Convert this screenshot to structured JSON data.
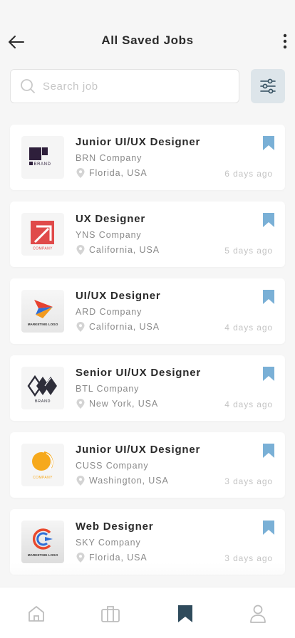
{
  "header": {
    "title": "All Saved Jobs"
  },
  "search": {
    "placeholder": "Search job",
    "value": ""
  },
  "colors": {
    "accent": "#2f4b5c",
    "bookmark": "#7ab0d6",
    "filter_bg": "#dde5ea"
  },
  "jobs": [
    {
      "title": "Junior UI/UX Designer",
      "company": "BRN Company",
      "location": "Florida, USA",
      "posted": "6 days ago",
      "logo_icon": "brn-brand-logo",
      "logo_text": "BRAND"
    },
    {
      "title": "UX Designer",
      "company": "YNS Company",
      "location": "California, USA",
      "posted": "5 days ago",
      "logo_icon": "yns-company-logo",
      "logo_text": "COMPANY"
    },
    {
      "title": "UI/UX Designer",
      "company": "ARD Company",
      "location": "California, USA",
      "posted": "4 days ago",
      "logo_icon": "ard-marketing-logo",
      "logo_text": "MARKETING LOGO"
    },
    {
      "title": "Senior UI/UX Designer",
      "company": "BTL Company",
      "location": "New York, USA",
      "posted": "4 days ago",
      "logo_icon": "btl-brand-logo",
      "logo_text": "BRAND"
    },
    {
      "title": "Junior UI/UX Designer",
      "company": "CUSS Company",
      "location": "Washington, USA",
      "posted": "3 days ago",
      "logo_icon": "cuss-company-logo",
      "logo_text": "COMPANY"
    },
    {
      "title": "Web Designer",
      "company": "SKY Company",
      "location": "Florida, USA",
      "posted": "3 days ago",
      "logo_icon": "sky-marketing-logo",
      "logo_text": "MARKETING LOGO"
    }
  ],
  "nav": [
    {
      "icon": "home-icon",
      "active": false
    },
    {
      "icon": "briefcase-icon",
      "active": false
    },
    {
      "icon": "bookmark-icon",
      "active": true
    },
    {
      "icon": "profile-icon",
      "active": false
    }
  ]
}
